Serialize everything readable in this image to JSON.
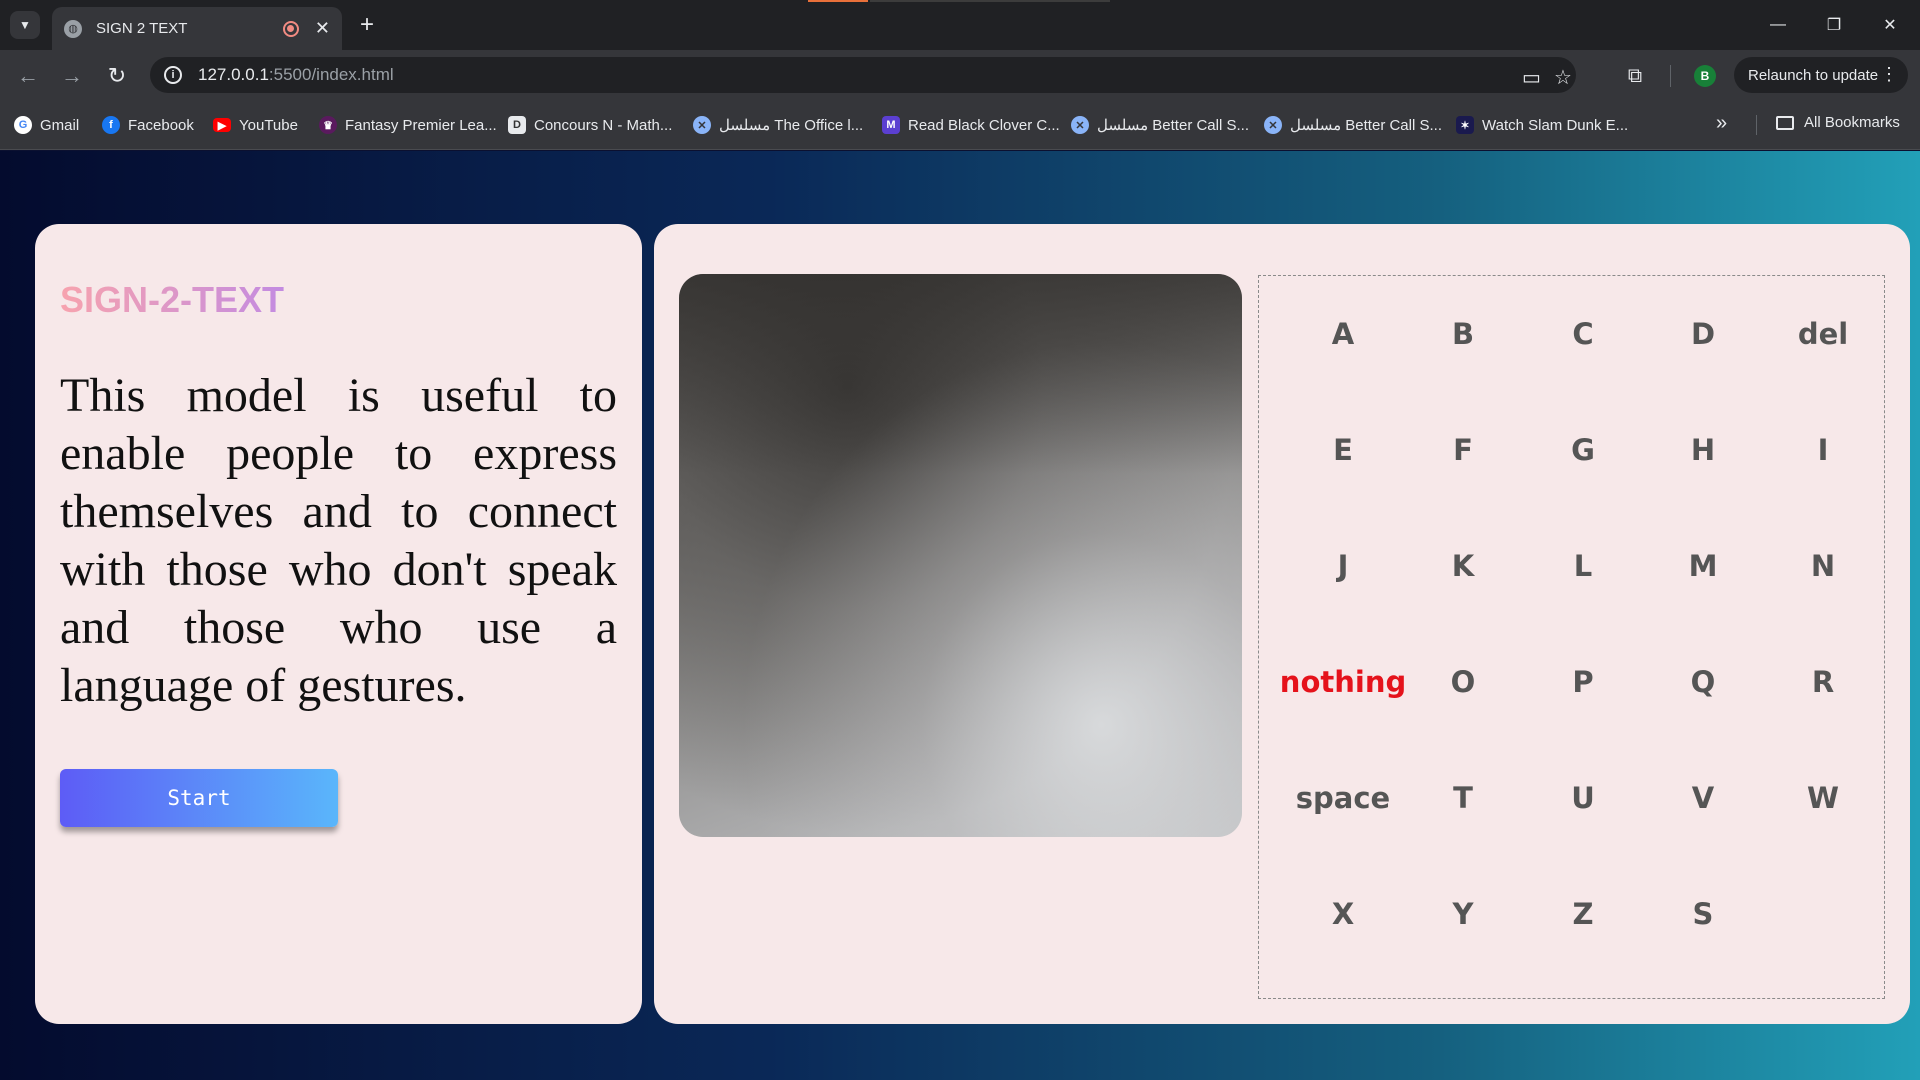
{
  "browser": {
    "tab_title": "SIGN 2 TEXT",
    "url_host": "127.0.0.1",
    "url_path": ":5500/index.html",
    "relaunch_label": "Relaunch to update",
    "profile_initial": "B",
    "bookmarks": [
      {
        "label": "Gmail",
        "icon": "google-icon",
        "color": "#ffffff"
      },
      {
        "label": "Facebook",
        "icon": "facebook-icon",
        "color": "#1877f2"
      },
      {
        "label": "YouTube",
        "icon": "youtube-icon",
        "color": "#ff0000"
      },
      {
        "label": "Fantasy Premier Lea...",
        "icon": "premier-league-icon",
        "color": "#5a1a5e"
      },
      {
        "label": "Concours N - Math...",
        "icon": "concours-icon",
        "color": "#e8eaed"
      },
      {
        "label": "مسلسل The Office l...",
        "icon": "globe-icon",
        "color": "#8ab4f8"
      },
      {
        "label": "Read Black Clover C...",
        "icon": "manga-icon",
        "color": "#5b3fd1"
      },
      {
        "label": "مسلسل Better Call S...",
        "icon": "globe-icon",
        "color": "#8ab4f8"
      },
      {
        "label": "مسلسل Better Call S...",
        "icon": "globe-icon",
        "color": "#8ab4f8"
      },
      {
        "label": "Watch Slam Dunk E...",
        "icon": "anime-icon",
        "color": "#1a1a4e"
      }
    ],
    "all_bookmarks_label": "All Bookmarks"
  },
  "app": {
    "brand": "SIGN-2-TEXT",
    "description": "This model is useful to enable people to express themselves and to connect with those who don't speak and those who use a language of gestures.",
    "start_label": "Start",
    "letters": [
      "A",
      "B",
      "C",
      "D",
      "del",
      "E",
      "F",
      "G",
      "H",
      "I",
      "J",
      "K",
      "L",
      "M",
      "N",
      "nothing",
      "O",
      "P",
      "Q",
      "R",
      "space",
      "T",
      "U",
      "V",
      "W",
      "X",
      "Y",
      "Z",
      "S"
    ],
    "active_letter": "nothing",
    "colors": {
      "active": "#e5121b",
      "inactive": "#555555",
      "panel": "#f7e8e9"
    }
  }
}
